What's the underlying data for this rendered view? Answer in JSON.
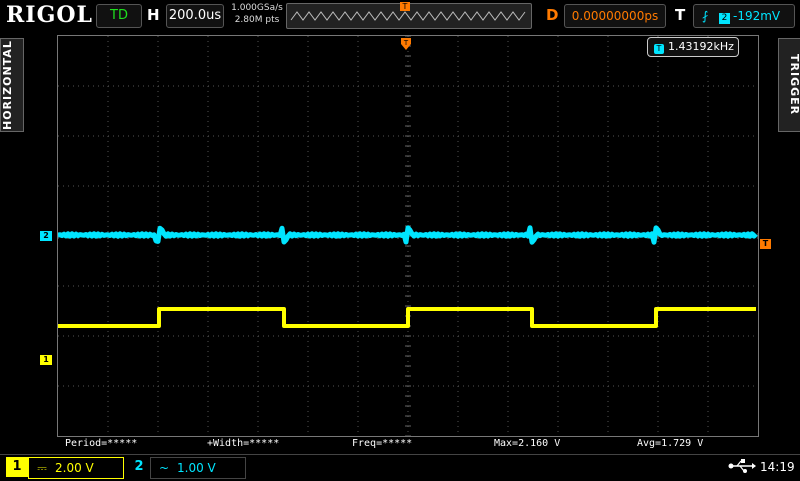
{
  "header": {
    "logo": "RIGOL",
    "run_status": "TD",
    "h_label": "H",
    "timebase": "200.0us",
    "sample_rate": "1.000GSa/s",
    "memory_depth": "2.80M pts",
    "delay_label": "D",
    "delay": "0.00000000ps",
    "trigger_label": "T",
    "trigger_source": "2",
    "trigger_level": "-192mV",
    "trigger_marker": "T"
  },
  "side_tabs": {
    "left": "HORIZONTAL",
    "right": "TRIGGER"
  },
  "freq_counter": {
    "icon": "T",
    "value": "1.43192kHz"
  },
  "markers": {
    "ch2": "2",
    "ch1": "1",
    "trigger": "T"
  },
  "measurements": [
    "Period=*****",
    "+Width=*****",
    "Freq=*****",
    "Max=2.160 V",
    "Avg=1.729 V"
  ],
  "bottom": {
    "ch1_num": "1",
    "ch1_coupling": "⎓",
    "ch1_scale": "2.00 V",
    "ch2_num": "2",
    "ch2_coupling": "~",
    "ch2_scale": "1.00 V",
    "time": "14:19"
  },
  "colors": {
    "ch1": "#ffff00",
    "ch2": "#00e5ff",
    "trigger": "#ff7a00"
  }
}
